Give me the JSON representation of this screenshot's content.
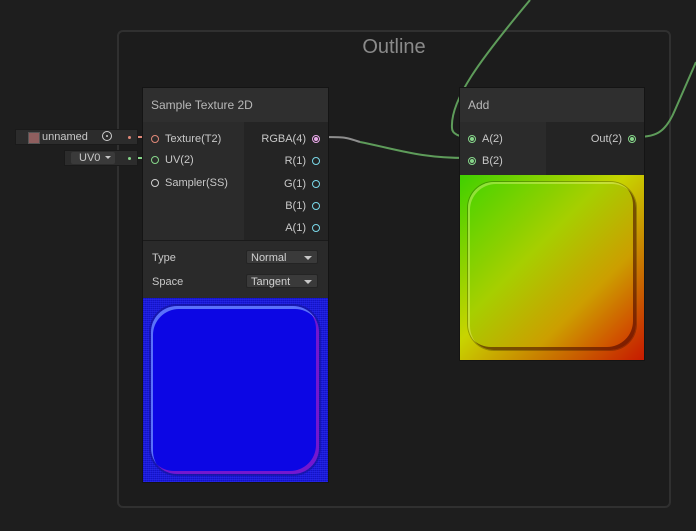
{
  "group": {
    "title": "Outline"
  },
  "sample_node": {
    "title": "Sample Texture 2D",
    "inputs": [
      {
        "label": "Texture(T2)",
        "color": "#e08878"
      },
      {
        "label": "UV(2)",
        "color": "#86d68a"
      },
      {
        "label": "Sampler(SS)",
        "color": "#cfcfcf"
      }
    ],
    "outputs": [
      {
        "label": "RGBA(4)",
        "color": "#e8a8e8"
      },
      {
        "label": "R(1)",
        "color": "#7ad8e8"
      },
      {
        "label": "G(1)",
        "color": "#7ad8e8"
      },
      {
        "label": "B(1)",
        "color": "#7ad8e8"
      },
      {
        "label": "A(1)",
        "color": "#7ad8e8"
      }
    ],
    "props": [
      {
        "label": "Type",
        "value": "Normal"
      },
      {
        "label": "Space",
        "value": "Tangent"
      }
    ]
  },
  "add_node": {
    "title": "Add",
    "inputs": [
      {
        "label": "A(2)",
        "color": "#86d68a"
      },
      {
        "label": "B(2)",
        "color": "#86d68a"
      }
    ],
    "outputs": [
      {
        "label": "Out(2)",
        "color": "#86d68a"
      }
    ]
  },
  "external_inputs": {
    "texture_name": "unnamed",
    "uv_value": "UV0"
  },
  "colors": {
    "background": "#1e1e1e",
    "wire_green": "#5e9c5a",
    "wire_grey": "#8e8e8e"
  }
}
